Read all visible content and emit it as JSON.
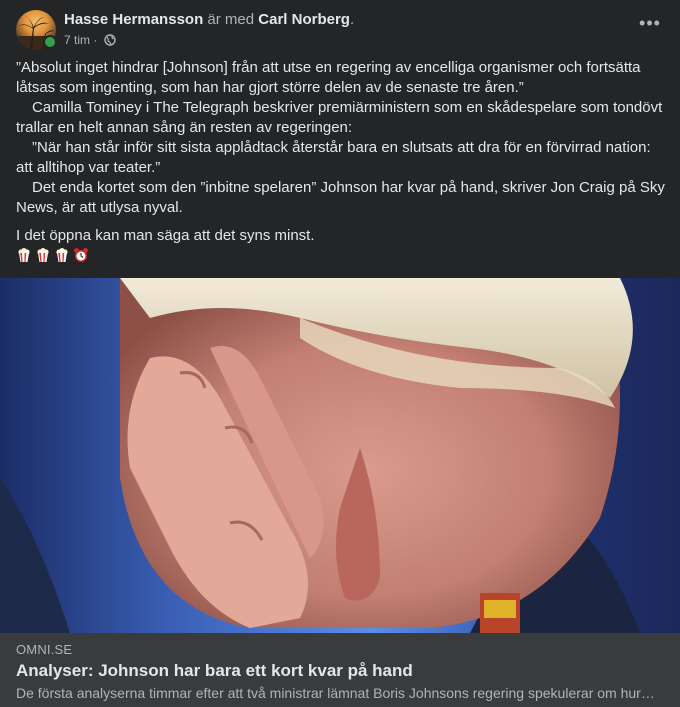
{
  "post": {
    "author": "Hasse Hermansson",
    "with_text": "är med",
    "tagged": "Carl Norberg",
    "period": ".",
    "time": "7 tim",
    "separator": "·",
    "privacy_icon": "globe-icon",
    "more_icon": "more-horizontal-icon",
    "more_label": "•••"
  },
  "body": {
    "paragraphs": [
      "”Absolut inget hindrar [Johnson] från att utse en regering av encelliga organismer och fortsätta låtsas som ingenting, som han har gjort större delen av de senaste tre åren.”",
      "Camilla Tominey i The Telegraph beskriver premiärministern som en skådespelare som tondövt trallar en helt annan sång än resten av regeringen:",
      "”När han står inför sitt sista applådtack återstår bara en slutsats att dra för en förvirrad nation: att alltihop var teater.”",
      "Det enda kortet som den ”inbitne spelaren” Johnson har kvar på hand, skriver Jon Craig på Sky News, är att utlysa nyval.",
      "I det öppna kan man säga att det syns minst."
    ],
    "emojis": [
      "popcorn-icon",
      "popcorn-icon",
      "popcorn-icon",
      "alarm-clock-icon"
    ]
  },
  "link": {
    "domain": "OMNI.SE",
    "title": "Analyser: Johnson har bara ett kort kvar på hand",
    "description": "De första analyserna timmar efter att två ministrar lämnat Boris Johnsons regering spekulerar om hur länge han klarar sig…"
  },
  "colors": {
    "background": "#242526",
    "link_preview_bg": "#3a3b3c",
    "primary_text": "#e4e6eb",
    "secondary_text": "#b0b3b8",
    "online": "#31a24c"
  }
}
